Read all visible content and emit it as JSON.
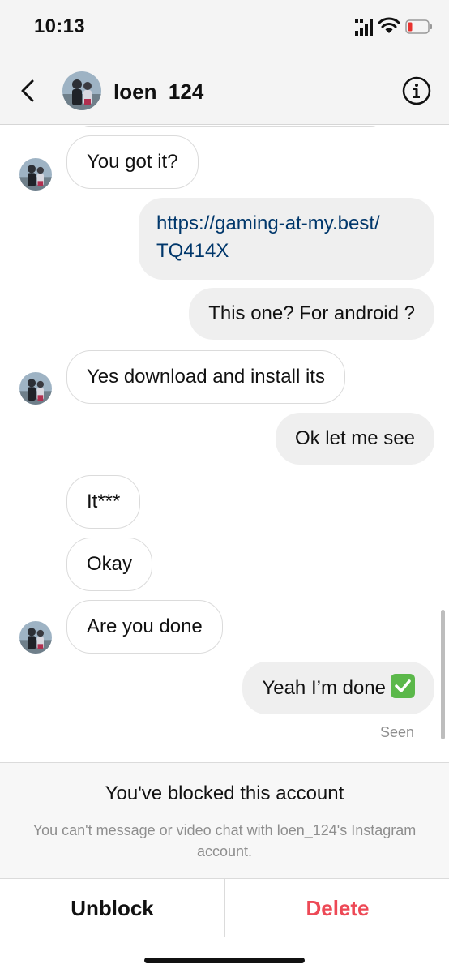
{
  "status_bar": {
    "time": "10:13"
  },
  "header": {
    "username": "loen_124"
  },
  "messages": [
    {
      "from": "them",
      "text": "You got it?"
    },
    {
      "from": "me",
      "text": "https://gaming-at-my.best/ TQ414X"
    },
    {
      "from": "me",
      "text": "This one? For android ?"
    },
    {
      "from": "them",
      "text": "Yes download and install its"
    },
    {
      "from": "me",
      "text": "Ok let me see"
    },
    {
      "from": "them",
      "text": "It***"
    },
    {
      "from": "them",
      "text": "Okay"
    },
    {
      "from": "them",
      "text": "Are you done"
    },
    {
      "from": "me",
      "text": "Yeah I’m done"
    }
  ],
  "seen_label": "Seen",
  "blocked_banner": {
    "title": "You've blocked this account",
    "description": "You can't message or video chat with loen_124's Instagram account."
  },
  "actions": {
    "unblock": "Unblock",
    "delete": "Delete"
  },
  "colors": {
    "delete": "#ed4956",
    "link": "#00376b",
    "emoji_check": "#5bb84a"
  },
  "icons": [
    "signal-icon",
    "wifi-icon",
    "battery-low-icon",
    "back-chevron-icon",
    "info-icon",
    "check-mark-emoji-icon"
  ]
}
